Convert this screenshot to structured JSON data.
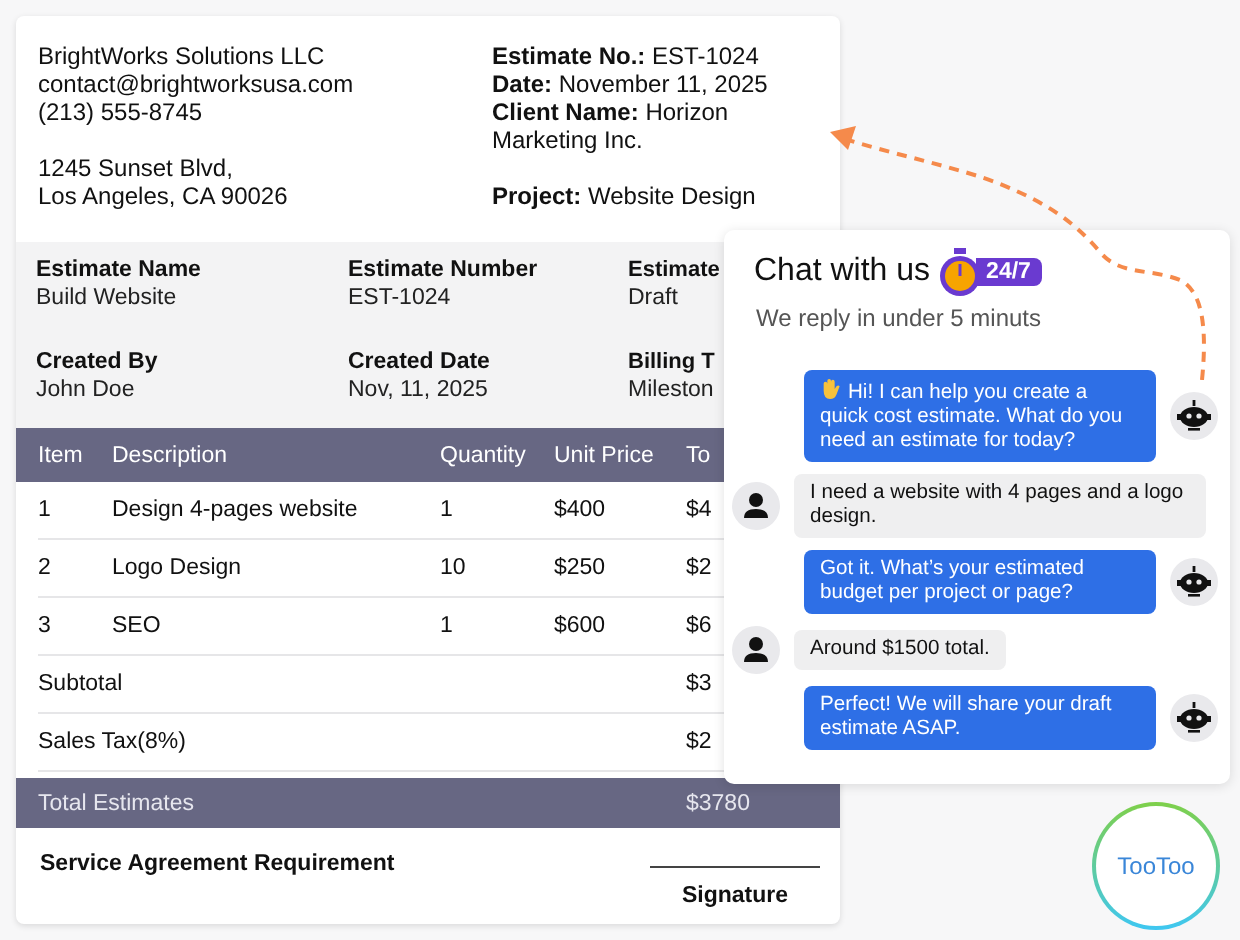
{
  "company": {
    "name": "BrightWorks Solutions LLC",
    "email": "contact@brightworksusa.com",
    "phone": "(213) 555-8745",
    "address_line_1": "1245 Sunset Blvd,",
    "address_line_2": "Los Angeles, CA 90026"
  },
  "estimate_meta": [
    {
      "label": "Estimate No.:",
      "value": "EST-1024"
    },
    {
      "label": "Date:",
      "value": "November 11, 2025"
    },
    {
      "label": "Client Name:",
      "value": "Horizon Marketing Inc."
    }
  ],
  "project": {
    "label": "Project:",
    "value": "Website Design"
  },
  "summary": [
    {
      "label": "Estimate Name",
      "value": "Build Website"
    },
    {
      "label": "Estimate Number",
      "value": "EST-1024"
    },
    {
      "label": "Estimate",
      "value": "Draft"
    },
    {
      "label": "Created By",
      "value": "John Doe"
    },
    {
      "label": "Created Date",
      "value": "Nov, 11, 2025"
    },
    {
      "label": "Billing T",
      "value": "Mileston"
    }
  ],
  "table": {
    "columns": [
      "Item",
      "Description",
      "Quantity",
      "Unit Price",
      "To"
    ],
    "rows": [
      [
        "1",
        "Design 4-pages website",
        "1",
        "$400",
        "$4"
      ],
      [
        "2",
        "Logo Design",
        "10",
        "$250",
        "$2"
      ],
      [
        "3",
        "SEO",
        "1",
        "$600",
        "$6"
      ]
    ],
    "totals": [
      {
        "label": "Subtotal",
        "value": "$3"
      },
      {
        "label": "Sales Tax(8%)",
        "value": "$2"
      }
    ],
    "grand_total": {
      "label": "Total Estimates",
      "value": "$3780"
    }
  },
  "footer": {
    "requirement": "Service Agreement Requirement",
    "signature": "Signature"
  },
  "chat": {
    "title": "Chat with us",
    "badge": "24/7",
    "subtitle": "We reply in under 5 minuts",
    "messages": [
      {
        "kind": "bot",
        "wave": true,
        "text": "Hi! I can help you create a quick cost estimate. What do you need an estimate for today?"
      },
      {
        "kind": "user",
        "text": "I need a website with 4 pages and a logo design."
      },
      {
        "kind": "bot",
        "text": "Got it. What’s your estimated budget per project or page?"
      },
      {
        "kind": "user",
        "text": "Around $1500 total."
      },
      {
        "kind": "bot",
        "text": "Perfect! We will share your draft estimate ASAP."
      }
    ]
  },
  "brand": {
    "label": "TooToo"
  }
}
